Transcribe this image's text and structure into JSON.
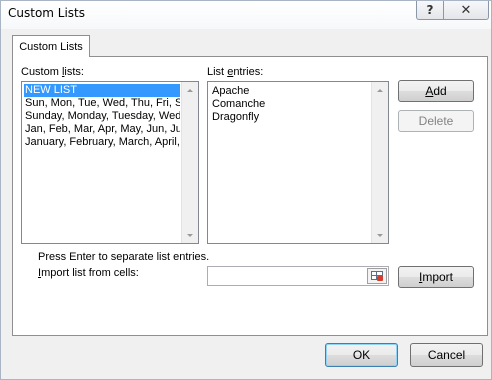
{
  "window": {
    "title": "Custom Lists",
    "help_symbol": "?",
    "close_symbol": "✕"
  },
  "tab": {
    "label": "Custom Lists"
  },
  "custom_lists": {
    "label_pre": "Custom ",
    "label_u": "l",
    "label_post": "ists:",
    "items": [
      "NEW LIST",
      "Sun, Mon, Tue, Wed, Thu, Fri, Sat",
      "Sunday, Monday, Tuesday, Wednesday, Thursday, Friday, Saturday",
      "Jan, Feb, Mar, Apr, May, Jun, Jul, Aug, Sep, Oct, Nov, Dec",
      "January, February, March, April, May, June, July, August, September, October, November, December"
    ],
    "selected_index": 0
  },
  "list_entries": {
    "label_pre": "List ",
    "label_u": "e",
    "label_post": "ntries:",
    "items": [
      "Apache",
      "Comanche",
      "Dragonfly"
    ]
  },
  "buttons": {
    "add_u": "A",
    "add_rest": "dd",
    "delete": "Delete",
    "import_u": "I",
    "import_rest": "mport",
    "ok": "OK",
    "cancel": "Cancel"
  },
  "hint_text": "Press Enter to separate list entries.",
  "import": {
    "label_u": "I",
    "label_rest": "mport list from cells:",
    "value": ""
  },
  "colors": {
    "selection": "#3399ff",
    "default_button_border": "#3c7fb1"
  }
}
